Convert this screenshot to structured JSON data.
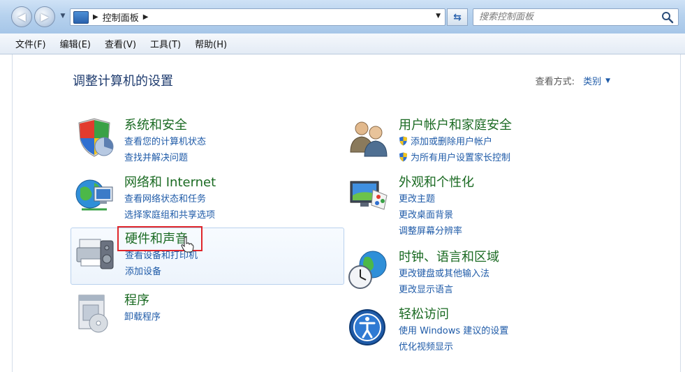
{
  "window": {
    "breadcrumb": "控制面板",
    "search_placeholder": "搜索控制面板"
  },
  "menu": [
    "文件(F)",
    "编辑(E)",
    "查看(V)",
    "工具(T)",
    "帮助(H)"
  ],
  "page": {
    "title": "调整计算机的设置",
    "view_label": "查看方式:",
    "view_value": "类别"
  },
  "categories": [
    {
      "title": "系统和安全",
      "icon": "shield-chart-icon",
      "links": [
        "查看您的计算机状态",
        "查找并解决问题"
      ]
    },
    {
      "title": "网络和 Internet",
      "icon": "network-globe-icon",
      "links": [
        "查看网络状态和任务",
        "选择家庭组和共享选项"
      ]
    },
    {
      "title": "硬件和声音",
      "icon": "printer-speaker-icon",
      "links": [
        "查看设备和打印机",
        "添加设备"
      ]
    },
    {
      "title": "程序",
      "icon": "programs-disc-icon",
      "links": [
        "卸载程序"
      ]
    },
    {
      "title": "用户帐户和家庭安全",
      "icon": "users-icon",
      "links": [
        "添加或删除用户帐户",
        "为所有用户设置家长控制"
      ]
    },
    {
      "title": "外观和个性化",
      "icon": "monitor-palette-icon",
      "links": [
        "更改主题",
        "更改桌面背景",
        "调整屏幕分辨率"
      ]
    },
    {
      "title": "时钟、语言和区域",
      "icon": "clock-globe-icon",
      "links": [
        "更改键盘或其他输入法",
        "更改显示语言"
      ]
    },
    {
      "title": "轻松访问",
      "icon": "ease-of-access-icon",
      "links": [
        "使用 Windows 建议的设置",
        "优化视频显示"
      ]
    }
  ]
}
